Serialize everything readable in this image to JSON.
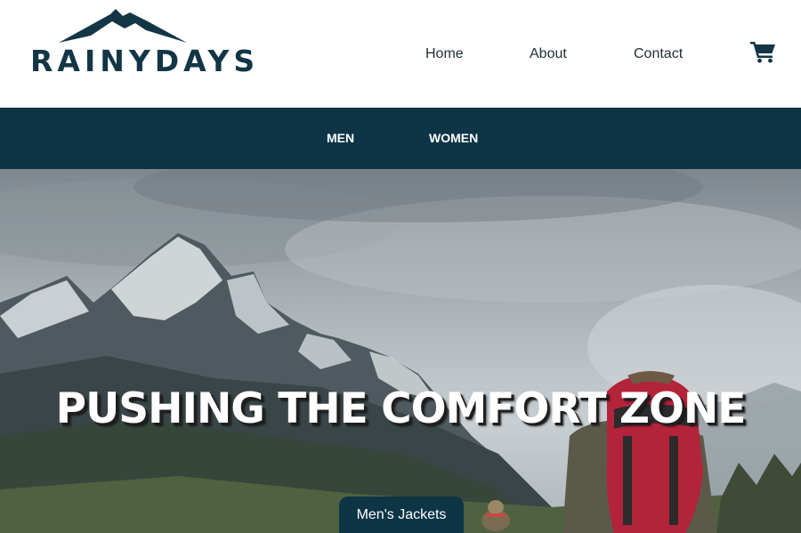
{
  "header": {
    "logo_text": "RAINYDAYS",
    "nav": {
      "home": "Home",
      "about": "About",
      "contact": "Contact"
    },
    "cart_icon": "shopping-cart-icon"
  },
  "categories": {
    "men": "MEN",
    "women": "WOMEN"
  },
  "hero": {
    "headline": "PUSHING THE COMFORT ZONE",
    "cta_label": "Men's Jackets"
  },
  "colors": {
    "brand_dark": "#0e3546",
    "logo": "#133646",
    "text": "#1d2d35",
    "white": "#ffffff"
  }
}
